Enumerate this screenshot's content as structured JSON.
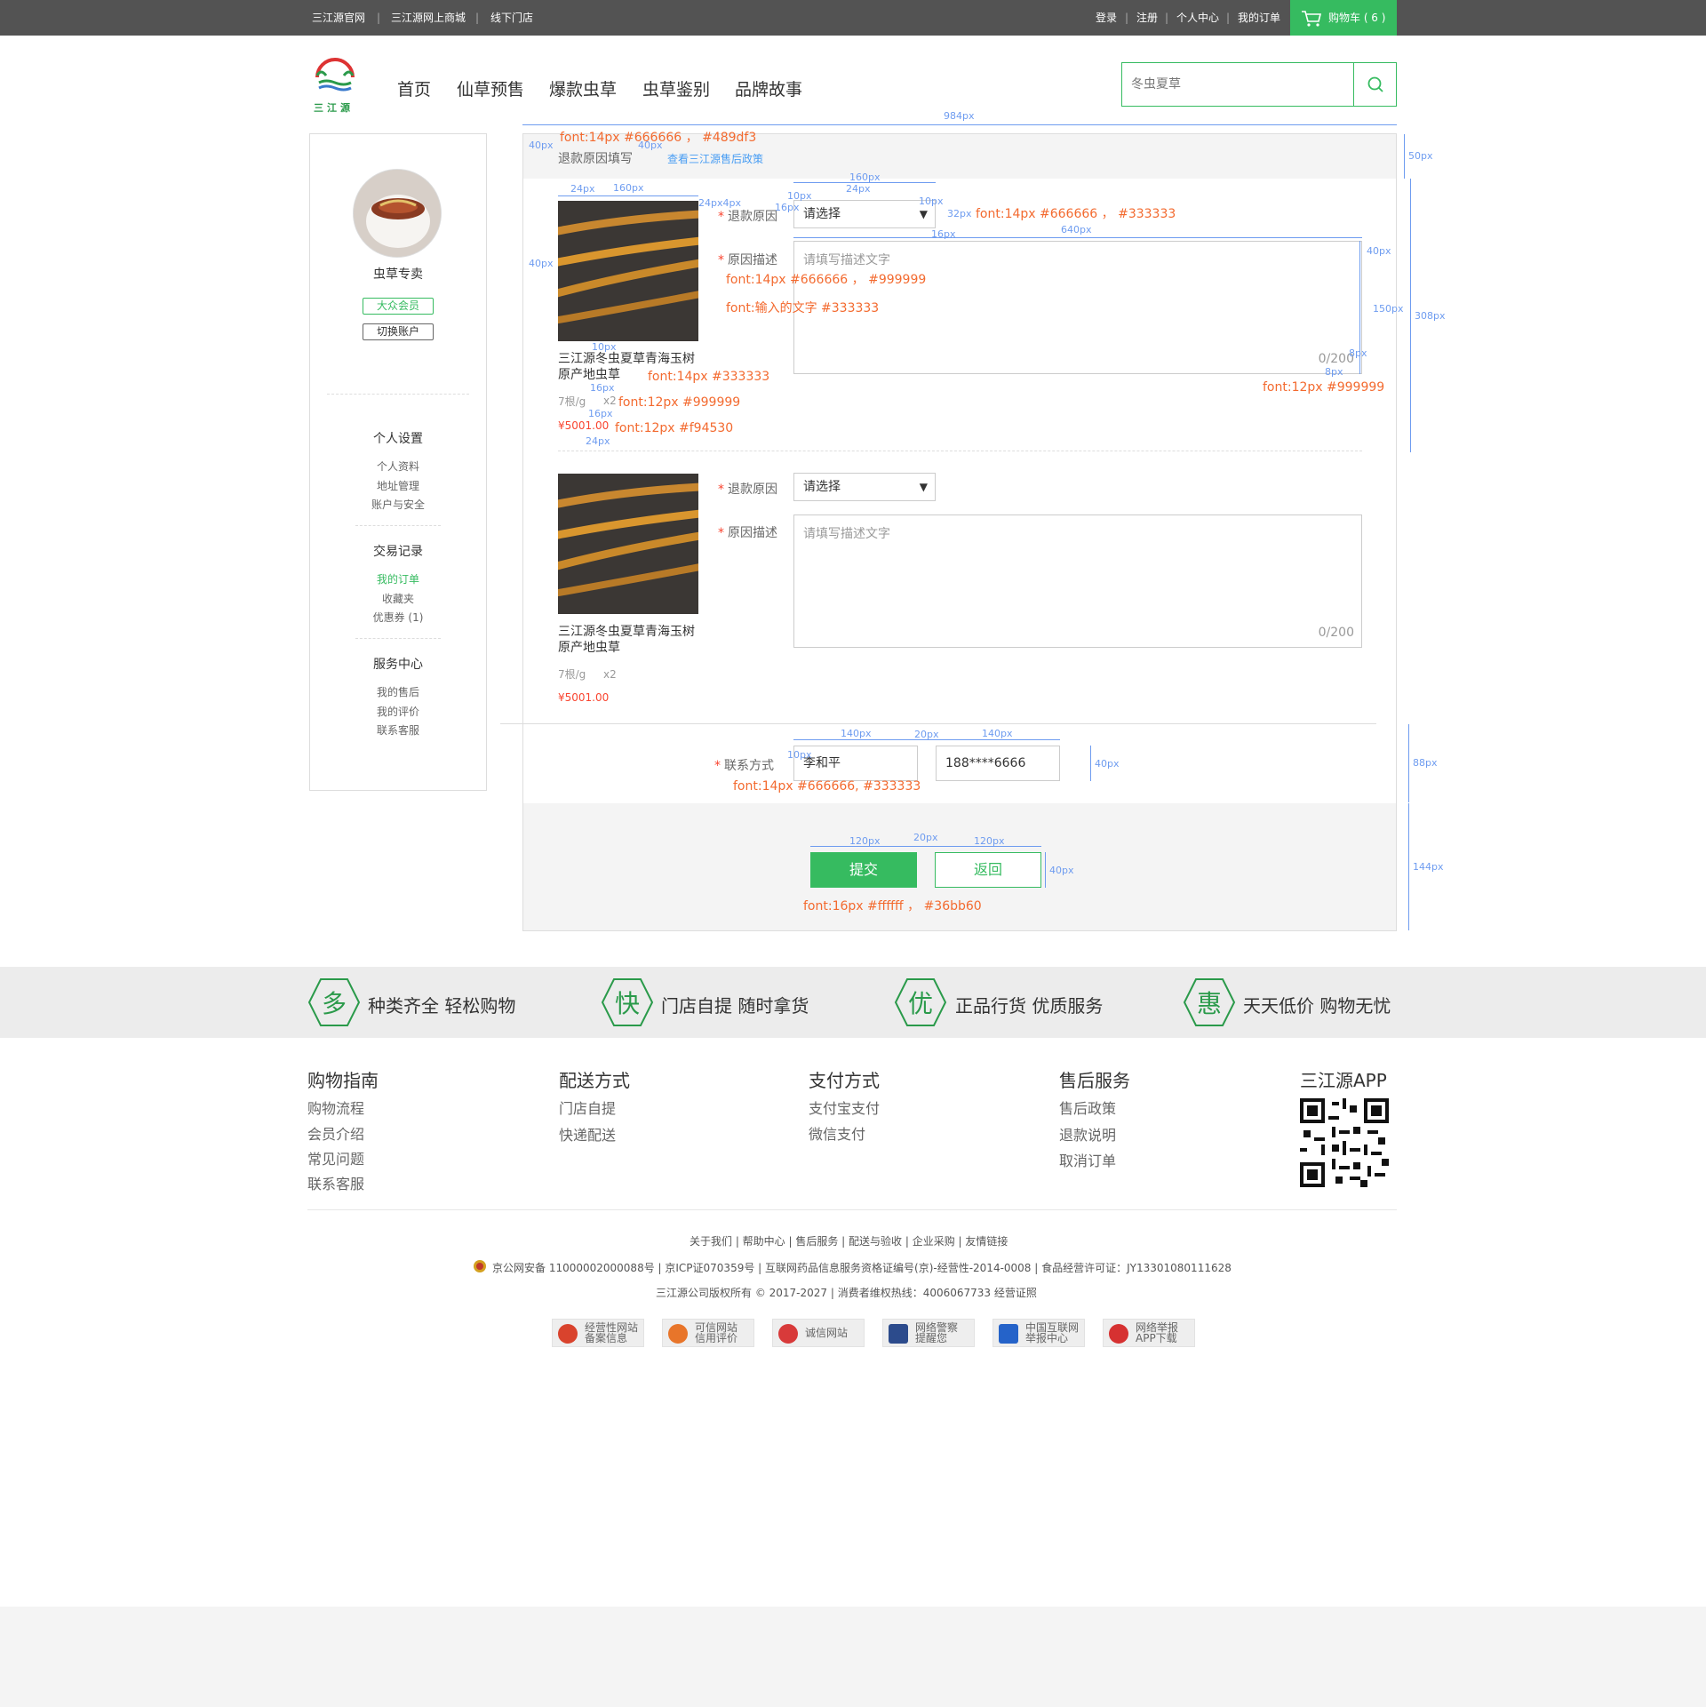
{
  "topbar": {
    "links": [
      "三江源官网",
      "三江源网上商城",
      "线下门店"
    ],
    "right_links": [
      "登录",
      "注册",
      "个人中心",
      "我的订单"
    ],
    "cart_label": "购物车 ( 6 )"
  },
  "header": {
    "logo_text": "三江源",
    "nav": [
      "首页",
      "仙草预售",
      "爆款虫草",
      "虫草鉴别",
      "品牌故事"
    ],
    "search_placeholder": "冬虫夏草"
  },
  "sidebar": {
    "username": "虫草专卖",
    "member_badge": "大众会员",
    "switch_account": "切换账户",
    "sections": [
      {
        "title": "个人设置",
        "items": [
          "个人资料",
          "地址管理",
          "账户与安全"
        ]
      },
      {
        "title": "交易记录",
        "items": [
          "我的订单",
          "收藏夹",
          "优惠券 (1)"
        ]
      },
      {
        "title": "服务中心",
        "items": [
          "我的售后",
          "我的评价",
          "联系客服"
        ]
      }
    ]
  },
  "main": {
    "header_title": "退款原因填写",
    "policy_link": "查看三江源售后政策",
    "items": [
      {
        "name_line1": "三江源冬虫夏草青海玉树",
        "name_line2": "原产地虫草",
        "spec": "7根/g",
        "qty": "x2",
        "price": "¥5001.00"
      },
      {
        "name_line1": "三江源冬虫夏草青海玉树",
        "name_line2": "原产地虫草",
        "spec": "7根/g",
        "qty": "x2",
        "price": "¥5001.00"
      }
    ],
    "reason_label": "退款原因",
    "reason_select": "请选择",
    "desc_label": "原因描述",
    "desc_placeholder": "请填写描述文字",
    "desc_counter": "0/200",
    "contact_label": "联系方式",
    "contact_name": "李和平",
    "contact_phone": "188****6666",
    "submit_label": "提交",
    "back_label": "返回"
  },
  "annotations": {
    "a1": "font:14px    #666666    ，    #489df3",
    "a2": "font:14px    #666666    ，    #333333",
    "a3": "font:14px    #666666    ，    #999999",
    "a4": "font:输入的文字   #333333",
    "a5": "font:14px    #333333",
    "a6": "font:12px    #999999",
    "a7": "font:12px    #f94530",
    "a8": "font:12px    #999999",
    "a9": "font:14px    #666666,  #333333",
    "a10": "font:16px    #ffffff    ，    #36bb60",
    "dims": {
      "d984": "984px",
      "d40a": "40px",
      "d40b": "40px",
      "d50": "50px",
      "d24a": "24px",
      "d160a": "160px",
      "d24b": "24px4px",
      "d160b": "160px",
      "d24c": "24px",
      "d10a": "10px",
      "d16a": "16px",
      "d10b": "10px",
      "d32": "32px",
      "d16b": "16px",
      "d640": "640px",
      "d40c": "40px",
      "d40d": "40px",
      "d150": "150px",
      "d308": "308px",
      "d8a": "8px",
      "d8b": "8px",
      "d10c": "10px",
      "d16c": "16px",
      "d16d": "16px",
      "d24d": "24px",
      "d140a": "140px",
      "d20a": "20px",
      "d140b": "140px",
      "d10d": "10px",
      "d40e": "40px",
      "d88": "88px",
      "d120a": "120px",
      "d20b": "20px",
      "d120b": "120px",
      "d40f": "40px",
      "d144": "144px"
    }
  },
  "promo": [
    {
      "char": "多",
      "text": "种类齐全 轻松购物"
    },
    {
      "char": "快",
      "text": "门店自提  随时拿货"
    },
    {
      "char": "优",
      "text": "正品行货  优质服务"
    },
    {
      "char": "惠",
      "text": "天天低价  购物无忧"
    }
  ],
  "footer": {
    "columns": [
      {
        "title": "购物指南",
        "links": [
          "购物流程",
          "会员介绍",
          "常见问题",
          "联系客服"
        ]
      },
      {
        "title": "配送方式",
        "links": [
          "门店自提",
          "快递配送"
        ]
      },
      {
        "title": "支付方式",
        "links": [
          "支付宝支付",
          "微信支付"
        ]
      },
      {
        "title": "售后服务",
        "links": [
          "售后政策",
          "退款说明",
          "取消订单"
        ]
      }
    ],
    "app_title": "三江源APP",
    "bottom_links": "关于我们  |  帮助中心  |  售后服务  |  配送与验收  |  企业采购  |  友情链接",
    "license_line": "京公网安备 11000002000088号   |  京ICP证070359号   |   互联网药品信息服务资格证编号(京)-经营性-2014-0008   |   食品经营许可证：JY13301080111628",
    "copyright_line": "三江源公司版权所有 © 2017-2027    |    消费者维权热线：4006067733     经营证照",
    "trust": [
      {
        "text": "经营性网站\n备案信息",
        "color": "#d9432d"
      },
      {
        "text": "可信网站\n信用评价",
        "color": "#e8752a"
      },
      {
        "text": "诚信网站",
        "color": "#d83a3a"
      },
      {
        "text": "网络警察\n提醒您",
        "color": "#2c4b8c"
      },
      {
        "text": "中国互联网\n举报中心",
        "color": "#2563c9"
      },
      {
        "text": "网络举报\nAPP下载",
        "color": "#d63131"
      }
    ]
  }
}
